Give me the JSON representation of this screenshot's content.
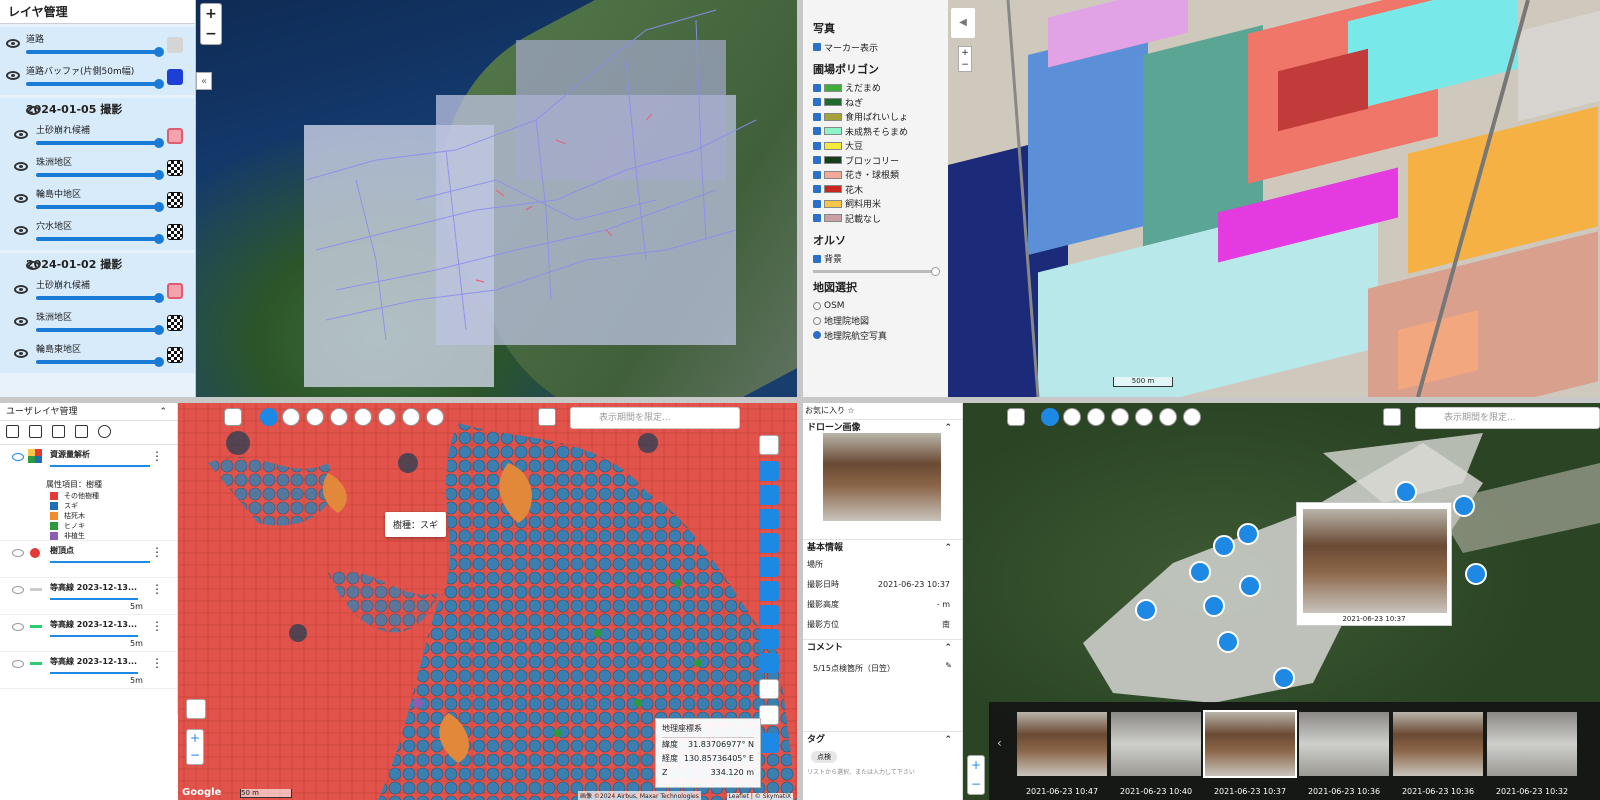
{
  "q1": {
    "title": "レイヤ管理",
    "base": [
      {
        "label": "道路",
        "swatch": "#d5d5d5"
      },
      {
        "label": "道路バッファ(片側50m幅)",
        "swatch": "#1d3fd6"
      }
    ],
    "groups": [
      {
        "title": "2024-01-05 撮影",
        "layers": [
          {
            "label": "土砂崩れ候補",
            "swatch": "#f4a3ad"
          },
          {
            "label": "珠洲地区",
            "swatch": "checker"
          },
          {
            "label": "輪島中地区",
            "swatch": "checker"
          },
          {
            "label": "穴水地区",
            "swatch": "checker"
          }
        ]
      },
      {
        "title": "2024-01-02 撮影",
        "layers": [
          {
            "label": "土砂崩れ候補",
            "swatch": "#f4a3ad"
          },
          {
            "label": "珠洲地区",
            "swatch": "checker"
          },
          {
            "label": "輪島東地区",
            "swatch": "checker"
          }
        ]
      }
    ],
    "zoom_in": "+",
    "zoom_out": "−",
    "collapse": "«"
  },
  "q2": {
    "photo_title": "写真",
    "marker": "マーカー表示",
    "polygon_title": "圃場ポリゴン",
    "crops": [
      {
        "label": "えだまめ",
        "color": "#3fae3a"
      },
      {
        "label": "ねぎ",
        "color": "#1f6b2e"
      },
      {
        "label": "食用ばれいしょ",
        "color": "#a6a23a"
      },
      {
        "label": "未成熟そらまめ",
        "color": "#8ff5c8"
      },
      {
        "label": "大豆",
        "color": "#f4ea3a"
      },
      {
        "label": "ブロッコリー",
        "color": "#183d1a"
      },
      {
        "label": "花き・球根類",
        "color": "#f4a898"
      },
      {
        "label": "花木",
        "color": "#c8261e"
      },
      {
        "label": "飼料用米",
        "color": "#f5c64a"
      },
      {
        "label": "記載なし",
        "color": "#c9a0a4"
      }
    ],
    "ortho_title": "オルソ",
    "background": "背景",
    "map_title": "地図選択",
    "maps": [
      {
        "label": "OSM",
        "on": false
      },
      {
        "label": "地理院地図",
        "on": false
      },
      {
        "label": "地理院航空写真",
        "on": true
      }
    ],
    "scale": "500 m",
    "back": "◀",
    "zoom_in": "+",
    "zoom_out": "−"
  },
  "q3": {
    "title": "ユーザレイヤ管理",
    "analysis": "資源量解析",
    "attr": "属性項目：樹種",
    "species": [
      {
        "label": "その他樹種",
        "color": "#e53935"
      },
      {
        "label": "スギ",
        "color": "#1e6fb8"
      },
      {
        "label": "枯死木",
        "color": "#f08c2a"
      },
      {
        "label": "ヒノキ",
        "color": "#2e9a3e"
      },
      {
        "label": "非植生",
        "color": "#8e5bb5"
      }
    ],
    "treetop": "樹頂点",
    "contours": [
      {
        "label": "等高線 2023-12-13...",
        "val": "5m"
      },
      {
        "label": "等高線 2023-12-13...",
        "val": "5m"
      },
      {
        "label": "等高線 2023-12-13...",
        "val": "5m"
      }
    ],
    "period_placeholder": "表示期間を限定...",
    "tooltip": "樹種：スギ",
    "coord_sys": "地理座標系",
    "lat_label": "緯度",
    "lat": "31.83706977° N",
    "lon_label": "経度",
    "lon": "130.85736405° E",
    "z_label": "Z",
    "z": "334.120 m",
    "google": "Google",
    "scale": "50 m",
    "credit": "画像 ©2024 Airbus, Maxar Technologies",
    "leaflet": "Leaflet | © SkymatiX",
    "zoom_in": "+",
    "zoom_out": "−"
  },
  "q4": {
    "fav": "お気に入り ☆",
    "drone": "ドローン画像",
    "basic": "基本情報",
    "place": "場所",
    "date_label": "撮影日時",
    "date": "2021-06-23 10:37",
    "alt_label": "撮影高度",
    "alt": "- m",
    "dir_label": "撮影方位",
    "dir": "南",
    "comment_title": "コメント",
    "comment": "5/15点検箇所（日笠）",
    "tag_title": "タグ",
    "tag": "点検",
    "tag_input": "リストから選択、または入力して下さい",
    "period_placeholder": "表示期間を限定...",
    "popup_date": "2021-06-23 10:37",
    "thumbs": [
      "2021-06-23 10:47",
      "2021-06-23 10:40",
      "2021-06-23 10:37",
      "2021-06-23 10:36",
      "2021-06-23 10:36",
      "2021-06-23 10:32"
    ],
    "zoom_in": "+",
    "zoom_out": "−"
  }
}
